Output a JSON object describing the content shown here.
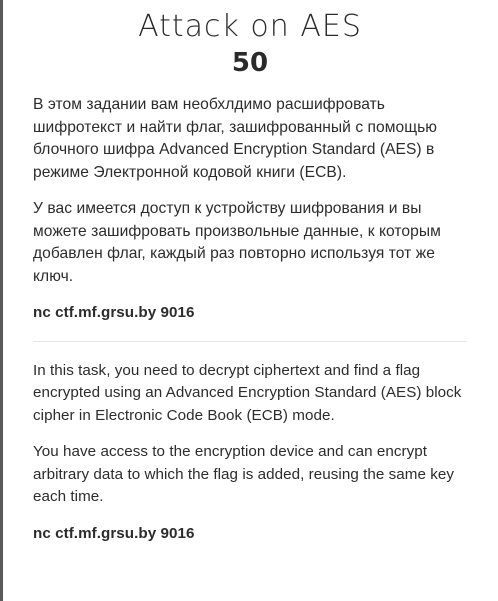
{
  "challenge": {
    "title": "Attack on AES",
    "points": "50",
    "description_ru": [
      "В этом задании вам необхлдимо расшифровать шифротекст и найти флаг, зашифрованный с помощью блочного шифра Advanced Encryption Standard (AES) в режиме Электронной кодовой книги (ECB).",
      "У вас имеется доступ к устройству шифрования и вы можете зашифровать произвольные данные, к которым добавлен флаг, каждый раз повторно используя тот же ключ."
    ],
    "connection_ru": "nc ctf.mf.grsu.by 9016",
    "description_en": [
      "In this task, you need to decrypt ciphertext and find a flag encrypted using an Advanced Encryption Standard (AES) block cipher in Electronic Code Book (ECB) mode.",
      "You have access to the encryption device and can encrypt arbitrary data to which the flag is added, reusing the same key each time."
    ],
    "connection_en": "nc ctf.mf.grsu.by 9016"
  }
}
